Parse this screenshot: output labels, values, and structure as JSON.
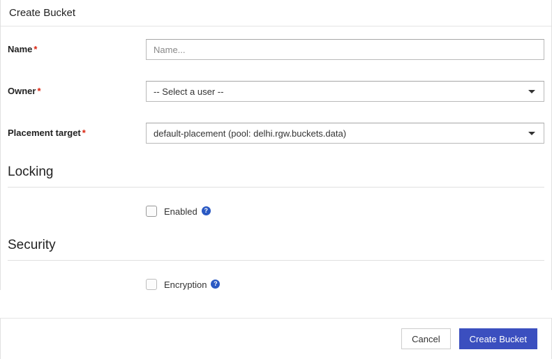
{
  "header": {
    "title": "Create Bucket"
  },
  "form": {
    "name": {
      "label": "Name",
      "placeholder": "Name...",
      "value": ""
    },
    "owner": {
      "label": "Owner",
      "selected": "-- Select a user --"
    },
    "placement_target": {
      "label": "Placement target",
      "selected": "default-placement (pool: delhi.rgw.buckets.data)"
    }
  },
  "sections": {
    "locking": {
      "title": "Locking",
      "enabled_label": "Enabled",
      "enabled_checked": false
    },
    "security": {
      "title": "Security",
      "encryption_label": "Encryption",
      "encryption_checked": false
    }
  },
  "footer": {
    "cancel": "Cancel",
    "submit": "Create Bucket"
  },
  "icons": {
    "help": "?"
  }
}
